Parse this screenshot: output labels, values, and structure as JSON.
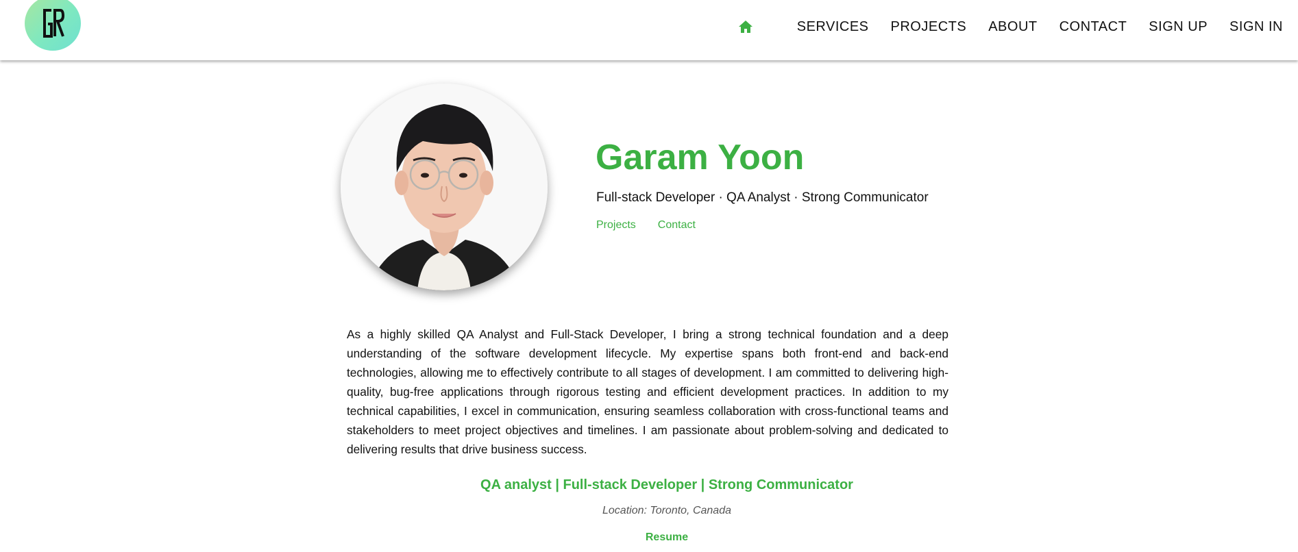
{
  "brand": {
    "logo_text": "GR",
    "accent_color": "#3cb043"
  },
  "nav": {
    "home_icon": "home-icon",
    "items": [
      "SERVICES",
      "PROJECTS",
      "ABOUT",
      "CONTACT",
      "SIGN UP",
      "SIGN IN"
    ]
  },
  "profile": {
    "name": "Garam Yoon",
    "tagline": "Full-stack Developer · QA Analyst · Strong Communicator",
    "links": [
      "Projects",
      "Contact"
    ],
    "bio": "As a highly skilled QA Analyst and Full-Stack Developer, I bring a strong technical foundation and a deep understanding of the software development lifecycle. My expertise spans both front-end and back-end technologies, allowing me to effectively contribute to all stages of development. I am committed to delivering high-quality, bug-free applications through rigorous testing and efficient development practices. In addition to my technical capabilities, I excel in communication, ensuring seamless collaboration with cross-functional teams and stakeholders to meet project objectives and timelines. I am passionate about problem-solving and dedicated to delivering results that drive business success.",
    "subheading": "QA analyst | Full-stack Developer | Strong Communicator",
    "location": "Location: Toronto, Canada",
    "resume_label": "Resume"
  }
}
